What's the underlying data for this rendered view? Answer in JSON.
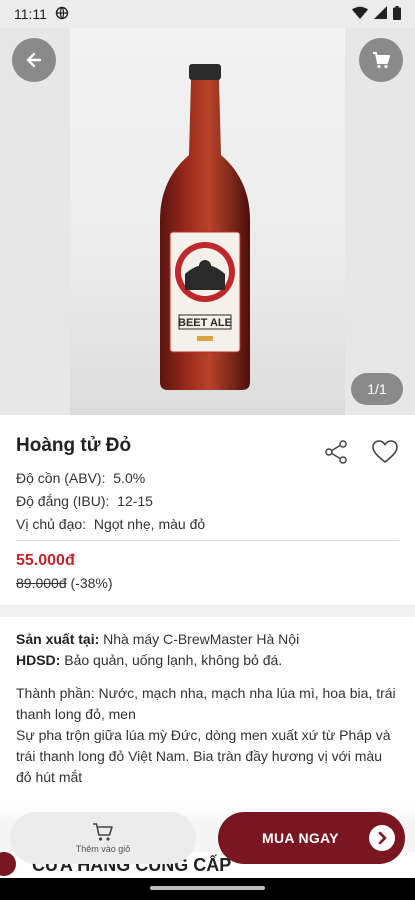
{
  "status_bar": {
    "time": "11:11"
  },
  "gallery": {
    "counter": "1/1",
    "bottle_label_text": "BEET ALE"
  },
  "product": {
    "name": "Hoàng tử Đỏ",
    "abv_label": "Độ cồn (ABV):",
    "abv_value": "5.0%",
    "ibu_label": "Độ đắng (IBU):",
    "ibu_value": "12-15",
    "taste_label": "Vị chủ đạo:",
    "taste_value": "Ngọt nhẹ, màu đỏ",
    "price": "55.000đ",
    "old_price": "89.000đ",
    "discount": "(-38%)"
  },
  "details": {
    "producer_label": "Sản xuất tại:",
    "producer_value": "Nhà máy C-BrewMaster Hà Nội",
    "usage_label": "HDSD:",
    "usage_value": "Bảo quản, uống lạnh, không bỏ đá.",
    "ingredients": "Thành phần: Nước, mạch nha, mạch nha lúa mì, hoa bia, trái thanh long đỏ, men",
    "description": "Sự pha trộn giữa lúa mỳ Đức, dòng men xuất xứ từ Pháp và trái thanh long đỏ Việt Nam. Bia tràn đầy hương vị với màu đỏ hút mắt"
  },
  "bottom_bar": {
    "add_to_cart_label": "Thêm vào giỏ",
    "buy_now_label": "MUA NGAY"
  },
  "next_section": {
    "title": "CỬA HÀNG CUNG CẤP"
  },
  "colors": {
    "brand": "#7a1522",
    "price": "#c0272d",
    "button_overlay": "#8a8a8a"
  },
  "icons": [
    "back-arrow-icon",
    "cart-icon",
    "share-icon",
    "heart-icon",
    "chevron-right-icon",
    "wifi-icon",
    "signal-icon",
    "battery-icon",
    "globe-icon"
  ]
}
